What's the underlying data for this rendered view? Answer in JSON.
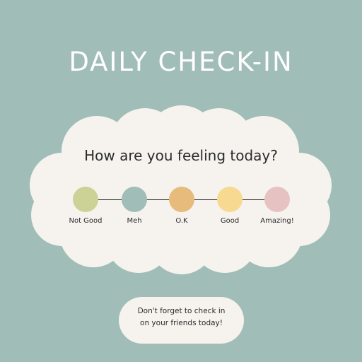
{
  "colors": {
    "background": "#a1bdb7",
    "card": "#f6f3ef",
    "text": "#2b2b2b",
    "title": "#ffffff"
  },
  "title": "DAILY CHECK-IN",
  "question": "How are you feeling today?",
  "moods": [
    {
      "label": "Not Good",
      "color": "#ccd196"
    },
    {
      "label": "Meh",
      "color": "#a1bdb7"
    },
    {
      "label": "O.K",
      "color": "#e6bb7c"
    },
    {
      "label": "Good",
      "color": "#f7d992"
    },
    {
      "label": "Amazing!",
      "color": "#e6c3c2"
    }
  ],
  "reminder": {
    "line1": "Don't forget to check in",
    "line2": "on your friends today!"
  }
}
